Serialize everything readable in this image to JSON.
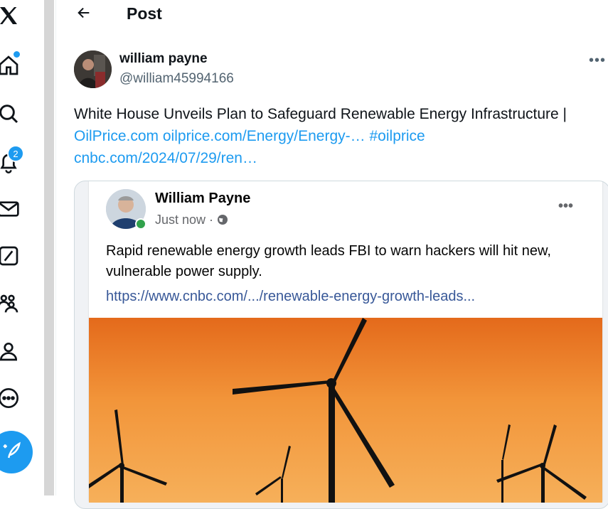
{
  "nav": {
    "icons": [
      "x-logo-icon",
      "home-icon",
      "explore-icon",
      "notifications-icon",
      "messages-icon",
      "grok-icon",
      "communities-icon",
      "profile-icon",
      "more-icon"
    ],
    "notifications_badge": "2",
    "post_button_icon": "compose-post-icon"
  },
  "header": {
    "title": "Post"
  },
  "tweet": {
    "author_name": "william payne",
    "author_handle": "@william45994166",
    "text_plain": "White House Unveils Plan to Safeguard Renewable Energy Infrastructure",
    "text_sep": "|",
    "link1": "OilPrice.com",
    "link2": "oilprice.com/Energy/Energy-…",
    "hashtag": "#oilprice",
    "link3": "cnbc.com/2024/07/29/ren…"
  },
  "embed": {
    "name": "William Payne",
    "time": "Just now ·",
    "text": "Rapid renewable energy growth leads FBI to warn hackers will hit new, vulnerable power supply.",
    "link": "https://www.cnbc.com/.../renewable-energy-growth-leads..."
  },
  "colors": {
    "accent": "#1d9bf0",
    "fb_link": "#385898",
    "online": "#31a24c"
  }
}
